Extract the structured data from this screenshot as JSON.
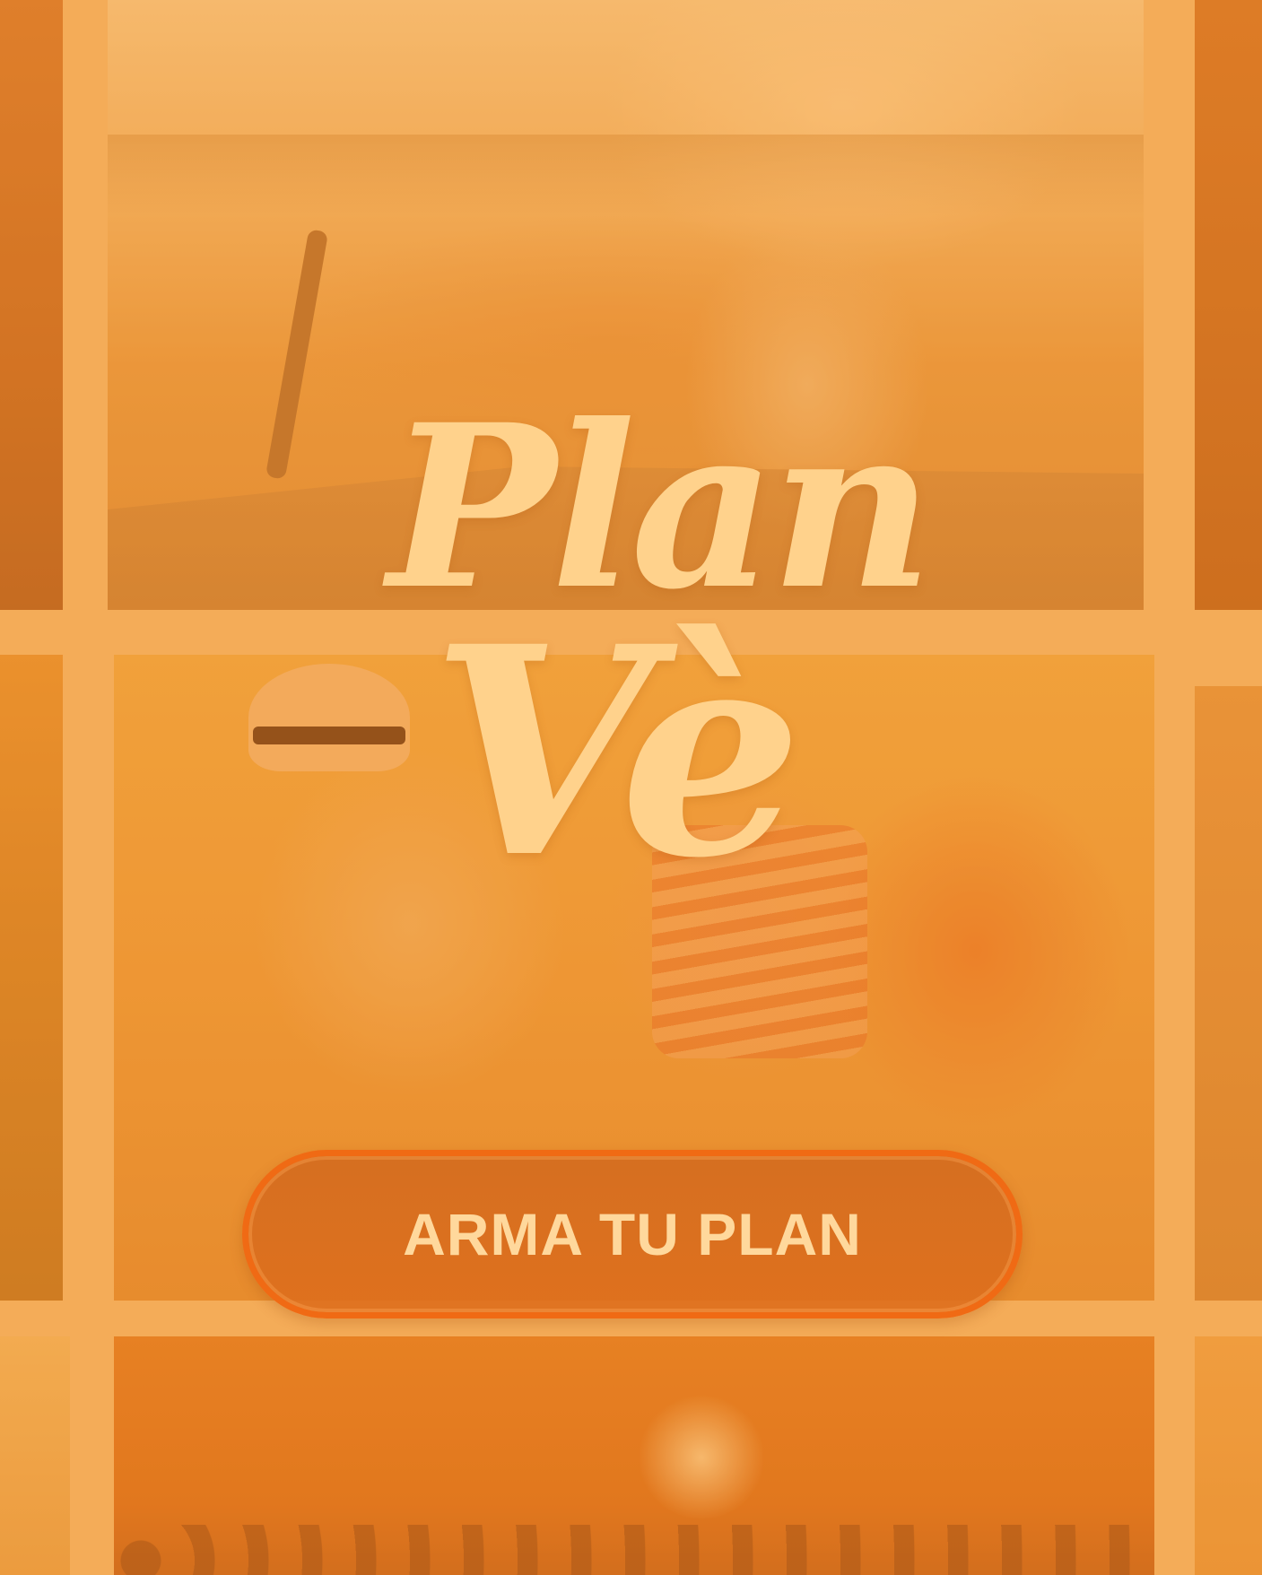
{
  "logo": {
    "line1": "Plan",
    "line2": "Vè"
  },
  "cta": {
    "label": "ARMA TU PLAN"
  },
  "colors": {
    "accent": "#f06a14",
    "title": "#ffd28c",
    "button_text": "#ffd89c",
    "background_tint": "#f4b366"
  }
}
